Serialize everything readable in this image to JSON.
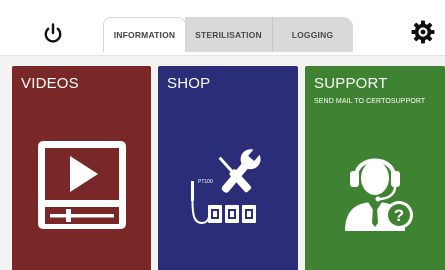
{
  "header": {
    "power_icon": "power-icon",
    "settings_icon": "gear-icon",
    "tabs": [
      {
        "label": "INFORMATION",
        "active": true
      },
      {
        "label": "STERILISATION",
        "active": false
      },
      {
        "label": "LOGGING",
        "active": false
      }
    ]
  },
  "tiles": {
    "videos": {
      "title": "VIDEOS",
      "color": "#7a2727",
      "icon": "video-player-icon"
    },
    "shop": {
      "title": "SHOP",
      "color": "#2b2d78",
      "icon": "probe-tools-icon",
      "probe_label": "PT100"
    },
    "support": {
      "title": "SUPPORT",
      "subtitle": "SEND MAIL TO CERTOSUPPORT",
      "color": "#3f8232",
      "icon": "support-agent-icon"
    }
  }
}
